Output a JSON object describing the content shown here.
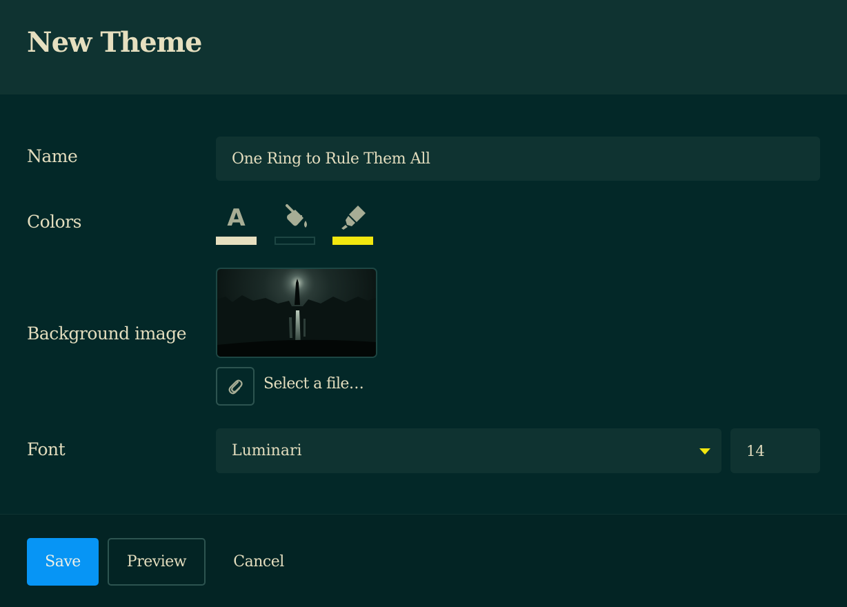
{
  "dialog": {
    "title": "New Theme"
  },
  "form": {
    "name": {
      "label": "Name",
      "value": "One Ring to Rule Them All"
    },
    "colors": {
      "label": "Colors",
      "text_color": "#e6dfbf",
      "background_color": "#032828",
      "highlight_color": "#f2e70f",
      "text_icon": "text-color-icon",
      "text_icon_glyph": "A",
      "background_icon": "paint-bucket-icon",
      "highlight_icon": "highlighter-icon"
    },
    "background_image": {
      "label": "Background image",
      "select_file_label": "Select a file…",
      "file_icon": "paperclip-icon"
    },
    "font": {
      "label": "Font",
      "selected": "Luminari",
      "size": "14"
    }
  },
  "footer": {
    "save_label": "Save",
    "preview_label": "Preview",
    "cancel_label": "Cancel"
  },
  "theme": {
    "accent": "#0795f5",
    "panel": "#0f3331",
    "background": "#032828",
    "text": "#e3ddbe",
    "caret": "#f2e70f"
  }
}
